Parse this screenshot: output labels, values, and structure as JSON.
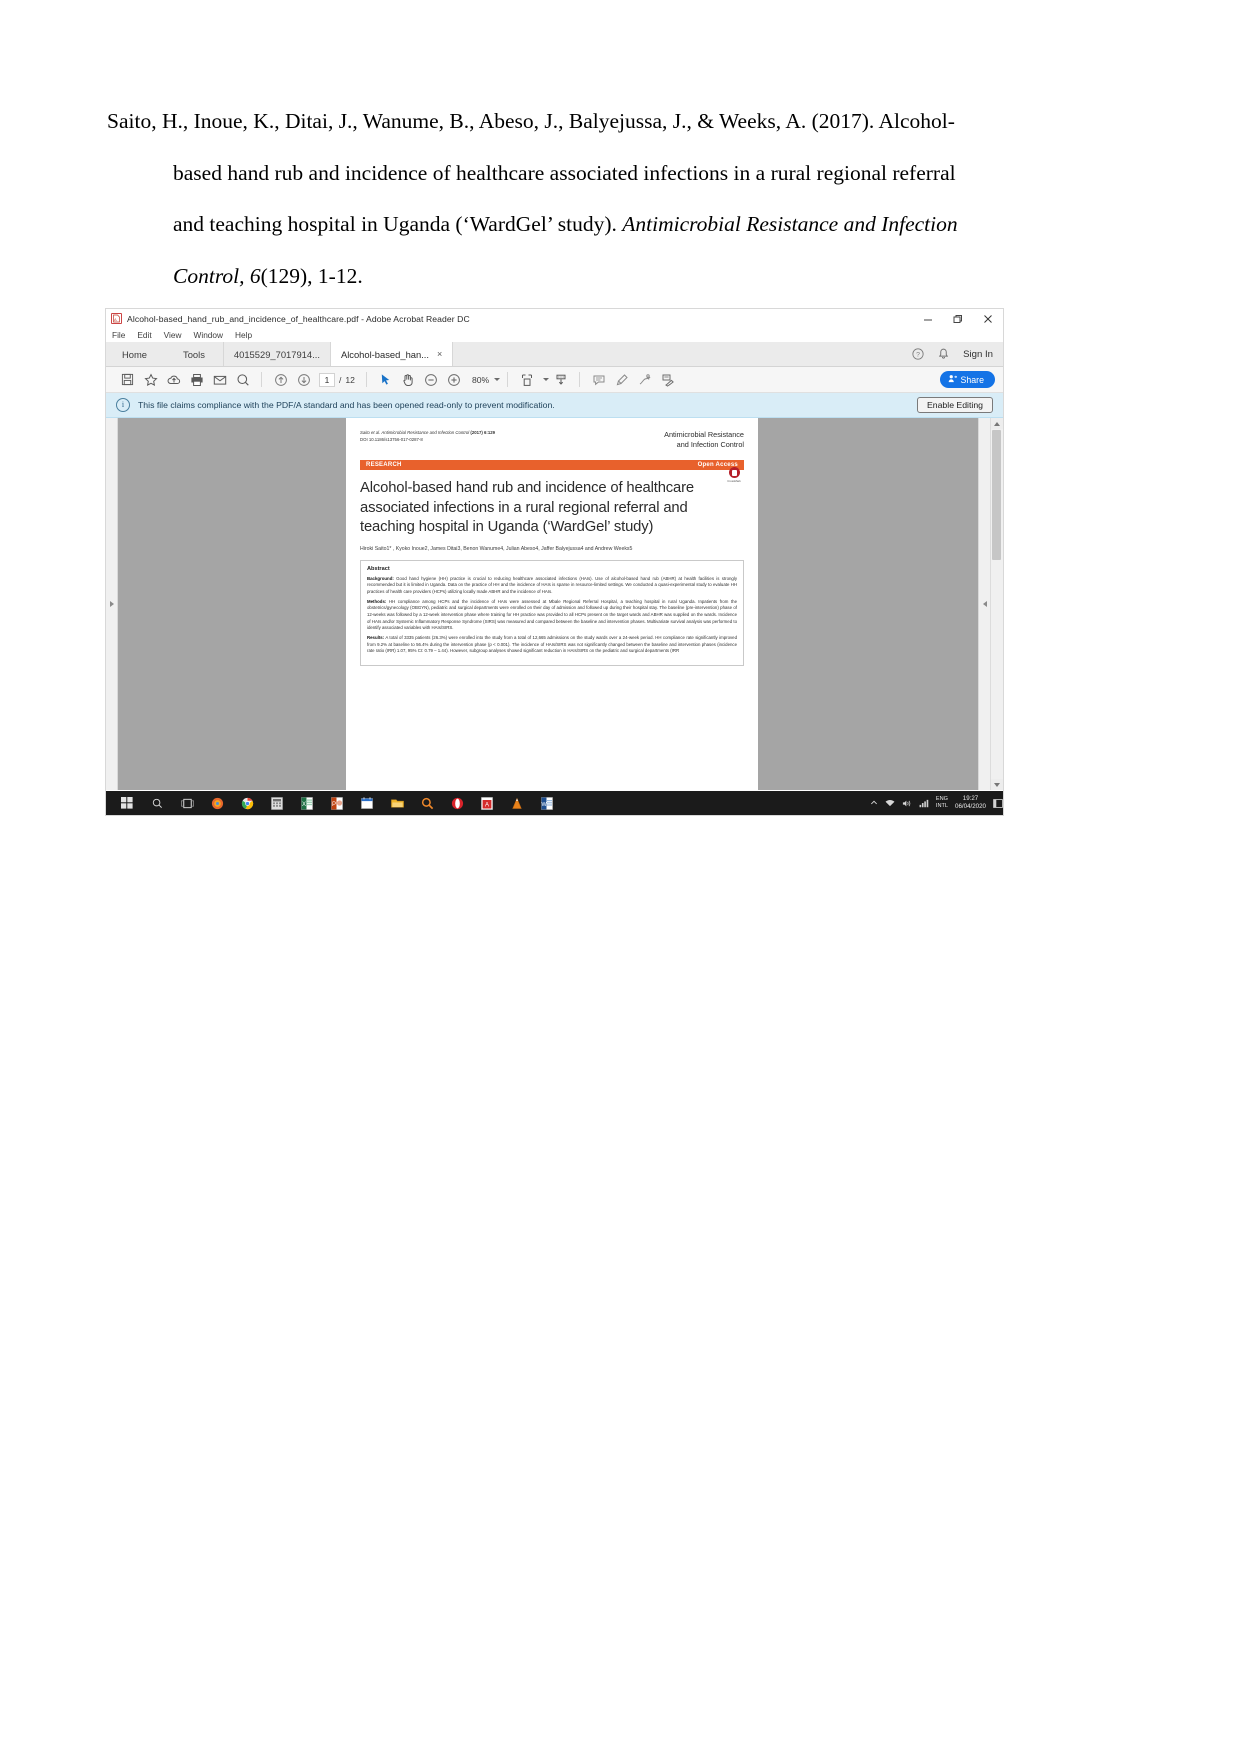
{
  "citation": {
    "lines": [
      {
        "text": "Saito, H., Inoue, K., Ditai, J., Wanume, B., Abeso, J., Balyejussa, J., & Weeks, A. (2017). Alcohol-",
        "indent": false
      },
      {
        "text": "based hand rub and incidence of healthcare associated infections in a rural regional referral",
        "indent": true
      }
    ],
    "line3_plain": "and teaching hospital in Uganda (‘WardGel’ study). ",
    "line3_italic": "Antimicrobial Resistance and Infection",
    "line4_italic": "Control, 6",
    "line4_plain": "(129), 1-12."
  },
  "window": {
    "title": "Alcohol-based_hand_rub_and_incidence_of_healthcare.pdf - Adobe Acrobat Reader DC",
    "app_icon": "acrobat-pdf-icon",
    "controls": {
      "minimize": "minimize-icon",
      "restore": "restore-icon",
      "close": "close-icon"
    }
  },
  "menubar": {
    "items": [
      "File",
      "Edit",
      "View",
      "Window",
      "Help"
    ]
  },
  "tabbar": {
    "home": "Home",
    "tools": "Tools",
    "documents": [
      {
        "label": "4015529_7017914...",
        "active": false,
        "closable": false
      },
      {
        "label": "Alcohol-based_han...",
        "active": true,
        "closable": true,
        "close_glyph": "×"
      }
    ],
    "help_icon": "help-circle-icon",
    "bell_icon": "notification-bell-icon",
    "signin": "Sign In"
  },
  "toolbar": {
    "tools": [
      "save-file-icon",
      "add-bookmark-star-icon",
      "upload-to-cloud-icon",
      "print-icon",
      "email-icon",
      "find-search-icon"
    ],
    "nav": [
      "previous-page-arrow-icon",
      "next-page-arrow-icon"
    ],
    "page_current": "1",
    "page_separator": "/",
    "page_total": "12",
    "select_tools": [
      "select-cursor-icon",
      "pan-hand-icon",
      "zoom-out-icon",
      "zoom-in-icon"
    ],
    "zoom_level": "80%",
    "fit_tools": [
      "fit-page-icon",
      "scroll-mode-icon"
    ],
    "annot_tools": [
      "add-comment-icon",
      "highlight-text-icon",
      "draw-markup-icon",
      "fill-and-sign-icon"
    ],
    "share_label": "Share",
    "share_icon": "share-person-icon",
    "share_color": "#1473e6"
  },
  "notice": {
    "icon": "info-circle-icon",
    "text": "This file claims compliance with the PDF/A standard and has been opened read-only to prevent modification.",
    "button": "Enable Editing",
    "background": "#d9edf7"
  },
  "viewer": {
    "left_arrow_icon": "panel-expand-right-icon",
    "right_arrow_icon": "panel-expand-left-icon",
    "scrollbar": {
      "up_icon": "scroll-up-arrow-icon",
      "down_icon": "scroll-down-arrow-icon"
    }
  },
  "pdf": {
    "running_head_italic": "Saito et al. Antimicrobial Resistance and Infection Control",
    "running_head_plain": "  (2017) 6:129",
    "doi": "DOI 10.1186/s13756-017-0287-8",
    "journal_line1": "Antimicrobial Resistance",
    "journal_line2": "and Infection Control",
    "research_label": "RESEARCH",
    "open_access_label": "Open Access",
    "accent_color": "#e8612c",
    "crossmark_label": "CrossMark",
    "title": "Alcohol-based hand rub and incidence of healthcare associated infections in a rural regional referral and teaching hospital in Uganda (‘WardGel’ study)",
    "authors": "Hiroki Saito1* , Kyoko Inoue2, James Ditai3, Benon Wanume4, Julian Abeso4, Jaffer Balyejussa4 and Andrew Weeks5",
    "abstract_heading": "Abstract",
    "abstract": [
      {
        "label": "Background:",
        "body": " Good hand hygiene (HH) practice is crucial to reducing healthcare associated infections (HAIs). Use of alcohol-based hand rub (ABHR) at health facilities is strongly recommended but it is limited in Uganda. Data on the practice of HH and the incidence of HAIs is sparse in resource-limited settings. We conducted a quasi-experimental study to evaluate HH practices of health care providers (HCPs) utilizing locally made ABHR and the incidence of HAIs."
      },
      {
        "label": "Methods:",
        "body": " HH compliance among HCPs and the incidence of HAIs were assessed at Mbale Regional Referral Hospital, a teaching hospital in rural Uganda. Inpatients from the obstetrics/gynecology (OBGYN), pediatric and surgical departments were enrolled on their day of admission and followed up during their hospital stay. The baseline (pre-intervention) phase of 12-weeks was followed by a 12-week intervention phase where training for HH practice was provided to all HCPs present on the target wards and ABHR was supplied on the wards. Incidence of HAIs and/or Systemic Inflammatory Response Syndrome (SIRS) was measured and compared between the baseline and intervention phases. Multivariate survival analysis was performed to identify associated variables with HAIs/SIRS."
      },
      {
        "label": "Results:",
        "body": " A total of 3335 patients (26.3%) were enrolled into the study from a total of 12,665 admissions on the study wards over a 24-week period. HH compliance rate significantly improved from 9.2% at baseline to 56.4% during the intervention phase (p < 0.001). The incidence of HAIs/SIRS was not significantly changed between the baseline and intervention phases (incidence rate ratio (IRR) 1.07, 95% CI: 0.79 – 1.44). However, subgroup analyses showed significant reduction in HAIs/SIRS on the pediatric and surgical departments (IRR"
      }
    ]
  },
  "taskbar": {
    "items": [
      "windows-start-icon",
      "search-icon",
      "task-view-icon",
      "firefox-icon",
      "chrome-icon",
      "calculator-icon",
      "excel-icon",
      "powerpoint-icon",
      "calendar-icon",
      "file-explorer-icon",
      "search-magnifier-orange-icon",
      "opera-icon",
      "acrobat-reader-icon",
      "vlc-cone-icon",
      "word-icon"
    ],
    "tray": {
      "chevron_up_icon": "show-hidden-icons-icon",
      "network_icon": "network-icon",
      "volume_icon": "volume-icon",
      "activity_icon": "activity-monitor-icon",
      "lang_line1": "ENG",
      "lang_line2": "INTL",
      "time": "19:27",
      "date": "06/04/2020",
      "notification_icon": "action-center-icon"
    }
  }
}
